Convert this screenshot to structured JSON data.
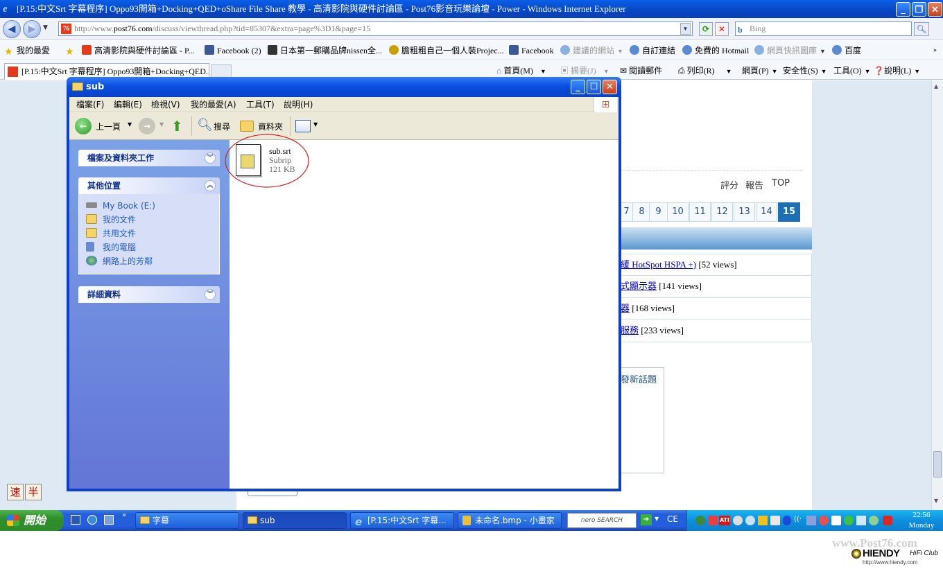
{
  "ie": {
    "window_title": "[P.15:中文Srt 字幕程序] Oppo93開箱+Docking+QED+oShare File Share 教學 - 高清影院與硬件討論區 - Post76影音玩樂論壇 - Power - Windows Internet Explorer",
    "address_prefix": "http://www.",
    "address_domain": "post76.com",
    "address_path": "/discuss/viewthread.php?tid=85307&extra=page%3D1&page=15",
    "search_placeholder": "Bing",
    "favorites_label": "我的最愛",
    "favorites": [
      "高清影院與硬件討論區 - P...",
      "Facebook (2)",
      "日本第一郵購品牌nissen全...",
      "膽粗粗自己一個人裝Projec...",
      "Facebook",
      "建議的網站",
      "自訂連結",
      "免費的 Hotmail",
      "網頁快訊圖庫",
      "百度"
    ],
    "tab_title": "[P.15:中文Srt 字幕程序] Oppo93開箱+Docking+QED...",
    "commands": [
      "首頁(M)",
      "摘要(J)",
      "閱讀郵件",
      "列印(R)",
      "網頁(P)",
      "安全性(S)",
      "工具(O)",
      "說明(L)"
    ]
  },
  "page": {
    "actions": [
      "評分",
      "報告",
      "TOP"
    ],
    "pages": [
      "7",
      "8",
      "9",
      "10",
      "11",
      "12",
      "13",
      "14",
      "15"
    ],
    "current_page": "15",
    "threads": [
      {
        "link": "緩 HotSpot HSPA +)",
        "views": "[52 views]"
      },
      {
        "link": "式顯示器",
        "views": "[141 views]"
      },
      {
        "link": "器",
        "views": "[168 views]"
      },
      {
        "link": "服務",
        "views": "[233 views]"
      }
    ],
    "new_topic": "發新話題"
  },
  "explorer": {
    "title": "sub",
    "menu": [
      "檔案(F)",
      "編輯(E)",
      "檢視(V)",
      "我的最愛(A)",
      "工具(T)",
      "說明(H)"
    ],
    "back_label": "上一頁",
    "search_label": "搜尋",
    "folders_label": "資料夾",
    "tasks_header": "檔案及資料夾工作",
    "places_header": "其他位置",
    "places": [
      "My Book (E:)",
      "我的文件",
      "共用文件",
      "我的電腦",
      "網路上的芳鄰"
    ],
    "details_header": "詳細資料",
    "file": {
      "name": "sub.srt",
      "type": "Subrip",
      "size": "121 KB"
    }
  },
  "taskbar": {
    "start_label": "開始",
    "buttons": [
      "字幕",
      "sub",
      "[P.15:中文Srt 字幕...",
      "未命名.bmp - 小畫家"
    ],
    "active_index": 1,
    "nero_label": "nero SEARCH",
    "lang": "CE",
    "clock_time": "22:56",
    "clock_day": "Monday"
  },
  "ime": [
    "速",
    "半"
  ],
  "watermark": {
    "site": "www.Post76.com",
    "brand": "HIENDY",
    "club": "HiFi Club",
    "url": "http://www.hiendy.com"
  }
}
